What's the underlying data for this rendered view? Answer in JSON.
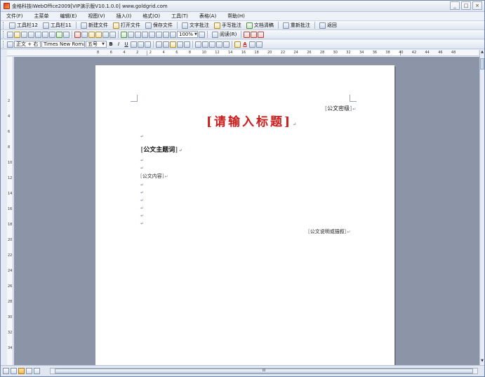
{
  "window": {
    "title": "金格科技iWebOffice2009[VIP演示版V10.1.0.0] www.goldgrid.com",
    "buttons": {
      "minimize": "_",
      "maximize": "□",
      "close": "×"
    }
  },
  "menu": [
    "文件(F)",
    "主菜单",
    "编辑(E)",
    "视图(V)",
    "插入(I)",
    "格式(O)",
    "工具(T)",
    "表格(A)",
    "帮助(H)"
  ],
  "toolbar1": [
    {
      "label": "工具栏12",
      "icon": "toolbar-icon"
    },
    {
      "label": "工具栏11",
      "icon": "toolbar-icon"
    },
    {
      "label": "新建文件",
      "icon": "new-file-icon"
    },
    {
      "label": "打开文件",
      "icon": "open-folder-icon"
    },
    {
      "label": "保存文件",
      "icon": "save-icon"
    },
    {
      "label": "文字批注",
      "icon": "text-comment-icon"
    },
    {
      "label": "手写批注",
      "icon": "pen-icon"
    },
    {
      "label": "文档清稿",
      "icon": "clean-doc-icon"
    },
    {
      "label": "重新批注",
      "icon": "recomment-icon"
    },
    {
      "label": "返回",
      "icon": "back-icon"
    }
  ],
  "toolbar2": {
    "zoom": "100%",
    "read_label": "阅读(R)"
  },
  "toolbar3": {
    "style": "正文 + 右",
    "font": "Times New Roman",
    "size": "五号",
    "bold": "B",
    "italic": "I",
    "underline": "U",
    "font_color_glyph": "A"
  },
  "ruler": {
    "h_numbers": [
      "8",
      "6",
      "4",
      "2",
      "2",
      "4",
      "6",
      "8",
      "10",
      "12",
      "14",
      "16",
      "18",
      "20",
      "22",
      "24",
      "26",
      "28",
      "30",
      "32",
      "34",
      "36",
      "38",
      "40",
      "42",
      "44",
      "46",
      "48"
    ],
    "v_numbers": [
      "2",
      "4",
      "6",
      "8",
      "10",
      "12",
      "14",
      "16",
      "18",
      "20",
      "22",
      "24",
      "26",
      "28",
      "30",
      "32",
      "34"
    ]
  },
  "document": {
    "secret_field": "公文密级",
    "headline": "请输入标题",
    "subject_field": "公文主题词",
    "content_field": "公文内容",
    "remark_field": "公文说明或描叙",
    "para_mark": "↵",
    "bracket_open": "[",
    "bracket_close": "]"
  },
  "statusbar": {
    "scroll_grip": "III"
  },
  "colors": {
    "headline": "#cc1d1d",
    "canvas": "#8c95a7",
    "paragraph_mark": "#6a7fa8"
  }
}
